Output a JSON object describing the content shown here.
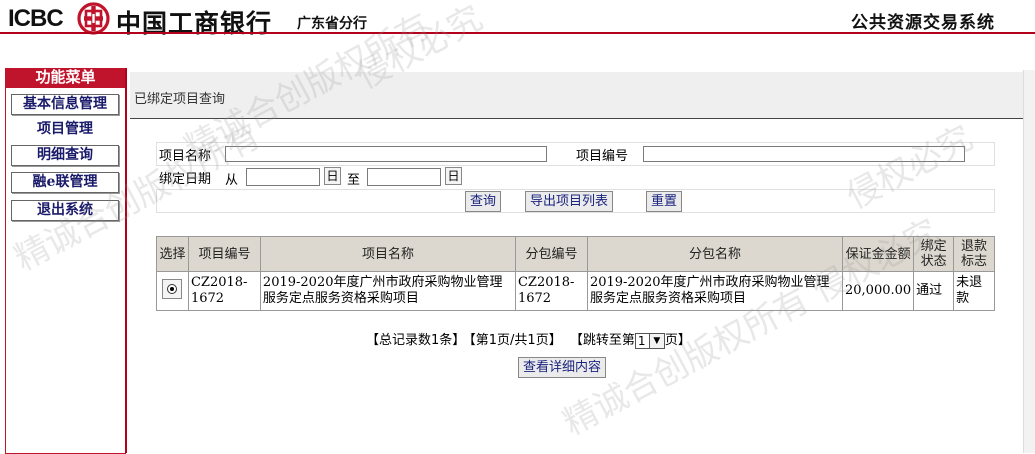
{
  "header": {
    "brand_en": "ICBC",
    "brand_cn": "中国工商银行",
    "branch": "广东省分行",
    "system_title": "公共资源交易系统"
  },
  "sidebar": {
    "title": "功能菜单",
    "items": [
      {
        "label": "基本信息管理",
        "style": "boxed"
      },
      {
        "label": "项目管理",
        "style": "plain"
      },
      {
        "label": "明细查询",
        "style": "boxed"
      },
      {
        "label": "融e联管理",
        "style": "boxed"
      },
      {
        "label": "退出系统",
        "style": "boxed"
      }
    ]
  },
  "page": {
    "title": "已绑定项目查询"
  },
  "form": {
    "project_name_label": "项目名称",
    "project_name_value": "",
    "project_code_label": "项目编号",
    "project_code_value": "",
    "bind_date_label": "绑定日期",
    "from_label": "从",
    "to_label": "至",
    "date_from_value": "",
    "date_to_value": "",
    "date_btn_label": "日",
    "query_button": "查询",
    "export_button": "导出项目列表",
    "reset_button": "重置"
  },
  "table": {
    "headers": [
      "选择",
      "项目编号",
      "项目名称",
      "分包编号",
      "分包名称",
      "保证金金额",
      "绑定状态",
      "退款标志"
    ],
    "rows": [
      {
        "selected": true,
        "project_code": "CZ2018-1672",
        "project_name": "2019-2020年度广州市政府采购物业管理服务定点服务资格采购项目",
        "package_code": "CZ2018-1672",
        "package_name": "2019-2020年度广州市政府采购物业管理服务定点服务资格采购项目",
        "deposit": "20,000.00",
        "bind_status": "通过",
        "refund_flag": "未退款"
      }
    ]
  },
  "pager": {
    "total": "【总记录数1条】",
    "page_info": "【第1页/共1页】",
    "jump_prefix": "【跳转至第",
    "page_value": "1",
    "jump_suffix": "页】",
    "detail_button": "查看详细内容"
  },
  "watermark": [
    "侵权必究",
    "精诚合创版权所有",
    "侵权必究",
    "精诚合创版权所有 侵权必究",
    "精诚合创版权所有"
  ],
  "colors": {
    "brand_red": "#c0142c",
    "header_th": "#ddd8cf"
  }
}
